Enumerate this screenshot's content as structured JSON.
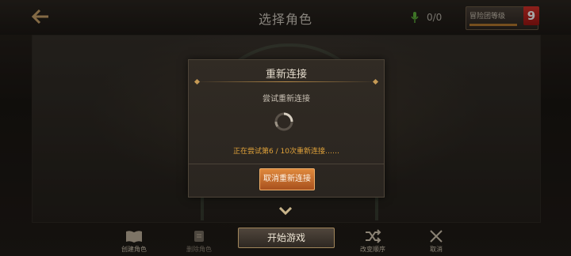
{
  "header": {
    "title": "选择角色",
    "mic_count": "0/0",
    "rank_label": "冒险团等级",
    "rank_level": "9"
  },
  "dialog": {
    "title": "重新连接",
    "message": "尝试重新连接",
    "status": "正在尝试第6 / 10次重新连接……",
    "cancel_label": "取消重新连接"
  },
  "bottom_bar": {
    "create_label": "创建角色",
    "delete_label": "删除角色",
    "start_label": "开始游戏",
    "reorder_label": "改变顺序",
    "cancel_label": "取消"
  },
  "colors": {
    "accent_orange": "#e0a23a",
    "button_orange": "#c96e2c",
    "badge_red": "#c9231e"
  },
  "icons": [
    "back-arrow-icon",
    "mic-icon",
    "spinner-icon",
    "chevron-down-icon",
    "book-icon",
    "delete-role-icon",
    "shuffle-icon",
    "close-icon"
  ]
}
